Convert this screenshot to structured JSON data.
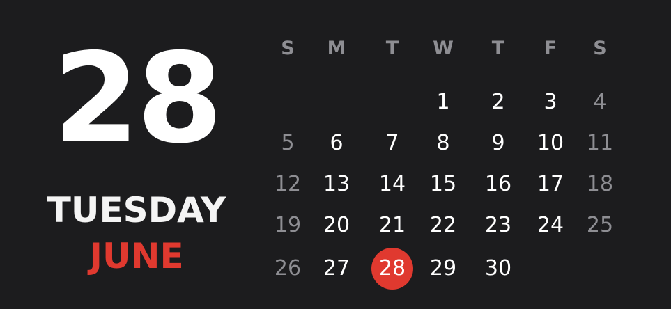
{
  "date": {
    "day_number": "28",
    "weekday": "TUESDAY",
    "month": "JUNE"
  },
  "calendar": {
    "weekday_headers": [
      "S",
      "M",
      "T",
      "W",
      "T",
      "F",
      "S"
    ],
    "weeks": [
      [
        "",
        "",
        "",
        "1",
        "2",
        "3",
        "4"
      ],
      [
        "5",
        "6",
        "7",
        "8",
        "9",
        "10",
        "11"
      ],
      [
        "12",
        "13",
        "14",
        "15",
        "16",
        "17",
        "18"
      ],
      [
        "19",
        "20",
        "21",
        "22",
        "23",
        "24",
        "25"
      ],
      [
        "26",
        "27",
        "28",
        "29",
        "30",
        "",
        ""
      ]
    ],
    "today": "28"
  },
  "colors": {
    "background": "#1c1c1e",
    "accent": "#e0392f",
    "muted": "#8e8e93",
    "text": "#ffffff"
  }
}
